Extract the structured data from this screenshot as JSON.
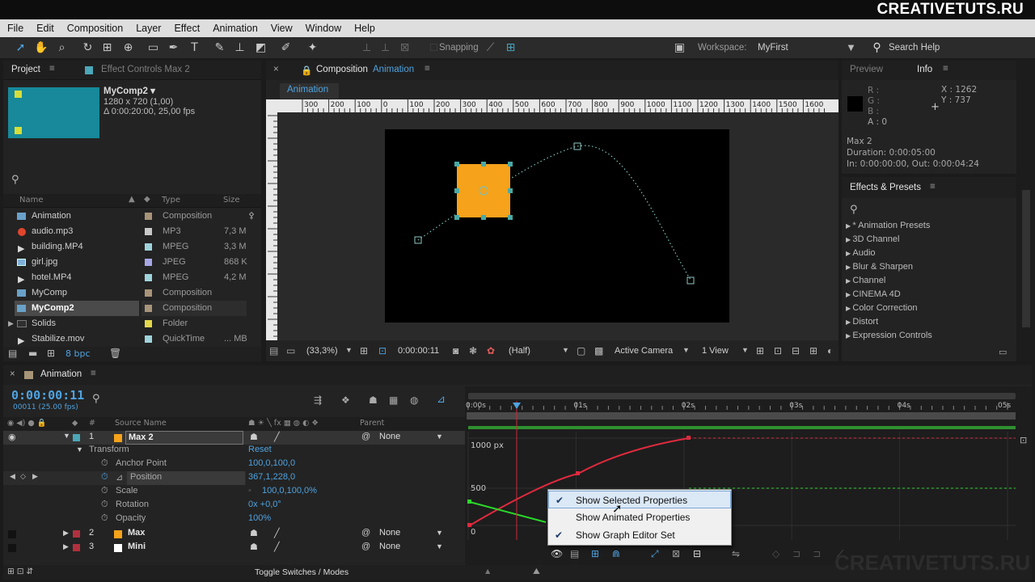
{
  "watermark": "CREATIVETUTS.RU",
  "menu": [
    "File",
    "Edit",
    "Composition",
    "Layer",
    "Effect",
    "Animation",
    "View",
    "Window",
    "Help"
  ],
  "toolbar": {
    "snapping": "Snapping",
    "workspace_label": "Workspace:",
    "workspace_value": "MyFirst",
    "search_help": "Search Help"
  },
  "project": {
    "tab_project": "Project",
    "tab_effects": "Effect Controls Max 2",
    "comp_name": "MyComp2 ▾",
    "comp_size": "1280 x 720 (1,00)",
    "comp_duration": "Δ 0:00:20:00, 25,00 fps",
    "search_icon": "search-icon",
    "columns": [
      "Name",
      "Type",
      "Size"
    ],
    "items": [
      {
        "name": "Animation",
        "type": "Composition",
        "size": "",
        "label": "#a89478"
      },
      {
        "name": "audio.mp3",
        "type": "MP3",
        "size": "7,3 M",
        "label": "#c8c8c8"
      },
      {
        "name": "building.MP4",
        "type": "MPEG",
        "size": "3,3 M",
        "label": "#9fd4dc"
      },
      {
        "name": "girl.jpg",
        "type": "JPEG",
        "size": "868 K",
        "label": "#a6a6e6"
      },
      {
        "name": "hotel.MP4",
        "type": "MPEG",
        "size": "4,2 M",
        "label": "#9fd4dc"
      },
      {
        "name": "MyComp",
        "type": "Composition",
        "size": "",
        "label": "#a89478"
      },
      {
        "name": "MyComp2",
        "type": "Composition",
        "size": "",
        "label": "#a89478"
      },
      {
        "name": "Solids",
        "type": "Folder",
        "size": "",
        "label": "#e4d84c"
      },
      {
        "name": "Stabilize.mov",
        "type": "QuickTime",
        "size": "... MB",
        "label": "#9fd4dc"
      }
    ],
    "bpc": "8 bpc"
  },
  "composition": {
    "tab_prefix": "Composition",
    "tab_name": "Animation",
    "sub_tab": "Animation",
    "ruler_labels": [
      "300",
      "200",
      "100",
      "0",
      "100",
      "200",
      "300",
      "400",
      "500",
      "600",
      "700",
      "800",
      "900",
      "1000",
      "1100",
      "1200",
      "1300",
      "1400",
      "1500",
      "1600"
    ],
    "zoom": "(33,3%)",
    "timecode": "0:00:00:11",
    "resolution": "(Half)",
    "camera": "Active Camera",
    "views": "1 View"
  },
  "info": {
    "tab_preview": "Preview",
    "tab_info": "Info",
    "r": "R :",
    "g": "G :",
    "b": "B :",
    "a": "A : 0",
    "x": "X : 1262",
    "y": "Y : 737",
    "layer": "Max 2",
    "duration": "Duration: 0:00:05:00",
    "inout": "In: 0:00:00:00, Out: 0:00:04:24"
  },
  "effects": {
    "title": "Effects & Presets",
    "items": [
      "* Animation Presets",
      "3D Channel",
      "Audio",
      "Blur & Sharpen",
      "Channel",
      "CINEMA 4D",
      "Color Correction",
      "Distort",
      "Expression Controls"
    ]
  },
  "timeline": {
    "tab": "Animation",
    "timecode": "0:00:00:11",
    "frames": "00011 (25.00 fps)",
    "col_source": "Source Name",
    "col_parent": "Parent",
    "time_labels": [
      "0:00s",
      "01s",
      "02s",
      "03s",
      "04s",
      "05s"
    ],
    "graph_labels": [
      "1000 px",
      "500",
      "0"
    ],
    "layers": [
      {
        "num": "1",
        "name": "Max 2",
        "parent": "None",
        "color": "#f6a21a"
      },
      {
        "num": "2",
        "name": "Max",
        "parent": "None",
        "color": "#f6a21a"
      },
      {
        "num": "3",
        "name": "Mini",
        "parent": "None",
        "color": "#ffffff"
      }
    ],
    "transform": "Transform",
    "reset": "Reset",
    "props": [
      {
        "name": "Anchor Point",
        "value": "100,0,100,0"
      },
      {
        "name": "Position",
        "value": "367,1,228,0"
      },
      {
        "name": "Scale",
        "value": "100,0,100,0%"
      },
      {
        "name": "Rotation",
        "value": "0x +0,0°"
      },
      {
        "name": "Opacity",
        "value": "100%"
      }
    ],
    "toggle": "Toggle Switches / Modes"
  },
  "context_menu": [
    {
      "label": "Show Selected Properties",
      "checked": true
    },
    {
      "label": "Show Animated Properties",
      "checked": false
    },
    {
      "label": "Show Graph Editor Set",
      "checked": true
    }
  ],
  "colors": {
    "accent_blue": "#4fa3e0",
    "layer_orange": "#f6a21a",
    "curve_red": "#e02a3e",
    "curve_green": "#2bd82b",
    "playhead": "#d0283a"
  }
}
